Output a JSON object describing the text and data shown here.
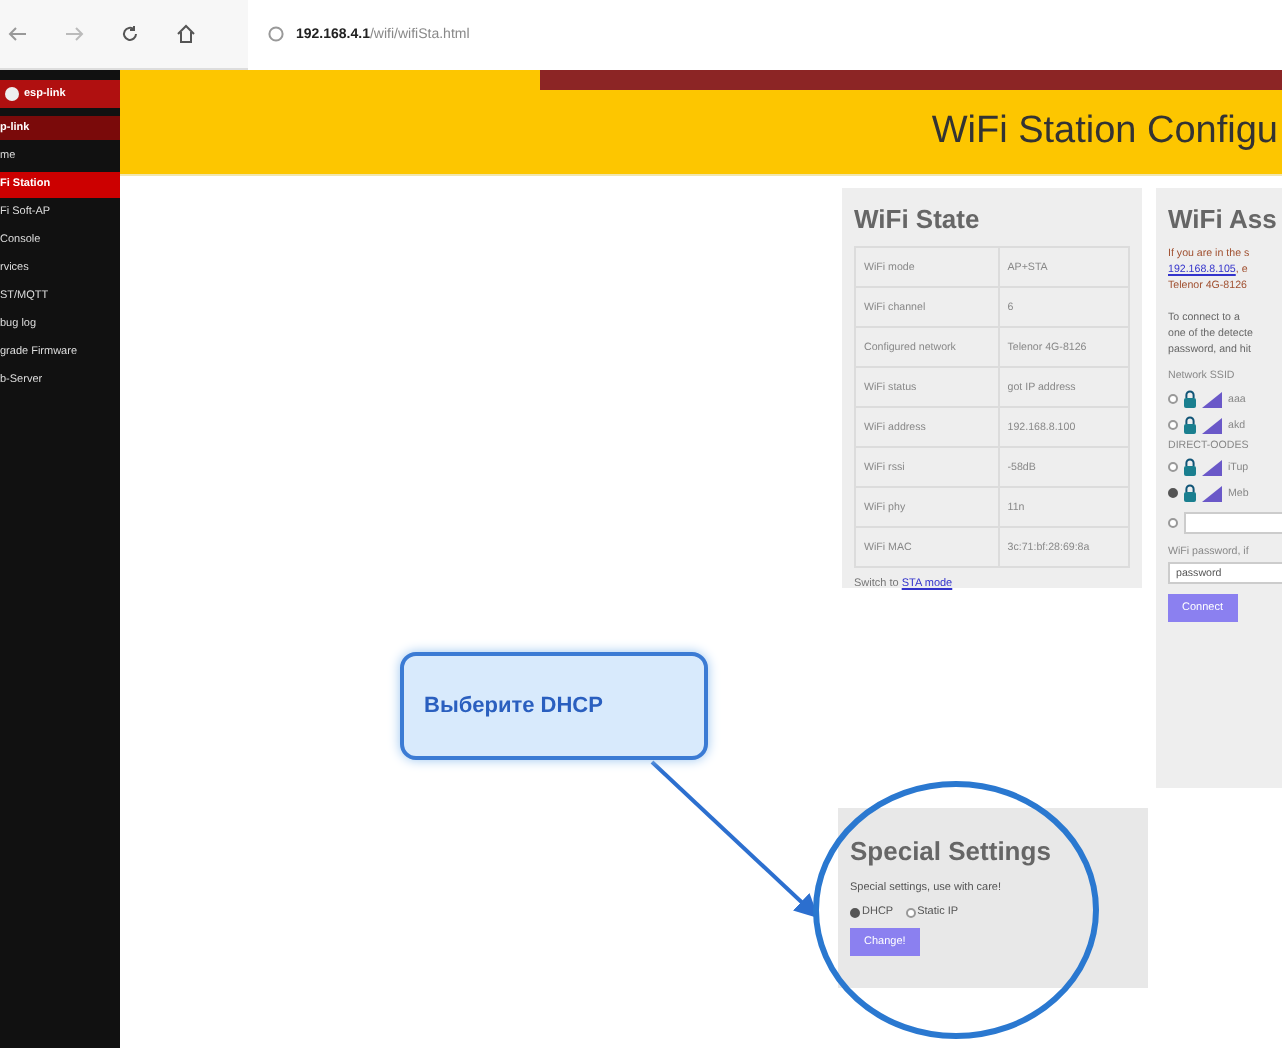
{
  "browser": {
    "url_host": "192.168.4.1",
    "url_path": "/wifi/wifiSta.html"
  },
  "sidebar": {
    "logo": "esp-link",
    "brand": "p-link",
    "items": [
      {
        "label": "me",
        "selected": false
      },
      {
        "label": "Fi Station",
        "selected": true
      },
      {
        "label": "Fi Soft-AP",
        "selected": false
      },
      {
        "label": "Console",
        "selected": false
      },
      {
        "label": "rvices",
        "selected": false
      },
      {
        "label": "ST/MQTT",
        "selected": false
      },
      {
        "label": "bug log",
        "selected": false
      },
      {
        "label": "grade Firmware",
        "selected": false
      },
      {
        "label": "b-Server",
        "selected": false
      }
    ]
  },
  "header": {
    "title": "WiFi Station Configu"
  },
  "wifi_state": {
    "title": "WiFi State",
    "rows": [
      {
        "label": "WiFi mode",
        "value": "AP+STA"
      },
      {
        "label": "WiFi channel",
        "value": "6"
      },
      {
        "label": "Configured network",
        "value": "Telenor 4G-8126"
      },
      {
        "label": "WiFi status",
        "value": "got IP address"
      },
      {
        "label": "WiFi address",
        "value": "192.168.8.100"
      },
      {
        "label": "WiFi rssi",
        "value": "-58dB"
      },
      {
        "label": "WiFi phy",
        "value": "11n"
      },
      {
        "label": "WiFi MAC",
        "value": "3c:71:bf:28:69:8a"
      }
    ],
    "switch_text": "Switch to",
    "switch_link": "STA mode"
  },
  "wifi_association": {
    "title": "WiFi Ass",
    "intro_start": "If you are in the s",
    "intro_link": "192.168.8.105",
    "intro_after": ", e",
    "intro_end": "Telenor 4G-8126",
    "instructions": "To connect to a\none of the detecte\npassword, and hit",
    "ssid_label": "Network SSID",
    "networks": [
      {
        "kind": "network",
        "name": "aaa",
        "selected": false
      },
      {
        "kind": "network",
        "name": "akd",
        "selected": false
      },
      {
        "kind": "text",
        "name": "DIRECT-OODES"
      },
      {
        "kind": "network",
        "name": "iTup",
        "selected": false
      },
      {
        "kind": "network",
        "name": "Meb",
        "selected": true
      },
      {
        "kind": "custom",
        "selected": false
      }
    ],
    "password_label": "WiFi password, if",
    "password_value": "password",
    "button": "Connect"
  },
  "special_settings": {
    "title": "Special Settings",
    "note": "Special settings, use with care!",
    "options": [
      {
        "label": "DHCP",
        "selected": true
      },
      {
        "label": "Static IP",
        "selected": false
      }
    ],
    "button": "Change!"
  },
  "callout": {
    "text": "Выберите DHCP"
  }
}
